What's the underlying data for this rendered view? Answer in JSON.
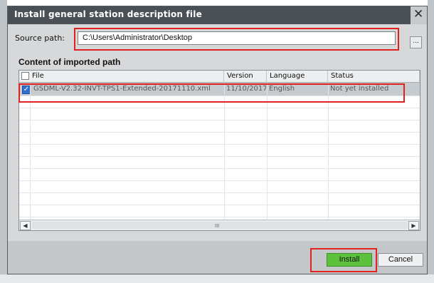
{
  "dialog": {
    "title": "Install general station description file",
    "close_icon": "close-icon"
  },
  "source": {
    "label": "Source path:",
    "value": "C:\\Users\\Administrator\\Desktop",
    "browse_label": "..."
  },
  "content": {
    "label": "Content of imported path",
    "columns": [
      "File",
      "Version",
      "Language",
      "Status"
    ],
    "rows": [
      {
        "checked": true,
        "file": "GSDML-V2.32-INVT-TPS1-Extended-20171110.xml",
        "version": "11/10/2017...",
        "language": "English",
        "status": "Not yet installed"
      }
    ]
  },
  "scrollbar": {
    "left_icon": "chevron-left-icon",
    "right_icon": "chevron-right-icon",
    "grip": "III"
  },
  "buttons": {
    "install_label": "Install",
    "cancel_label": "Cancel"
  },
  "colors": {
    "titlebar": "#4a5056",
    "install_button": "#5cc23e",
    "highlight": "#e0211d",
    "checkbox": "#2f6fd2"
  }
}
